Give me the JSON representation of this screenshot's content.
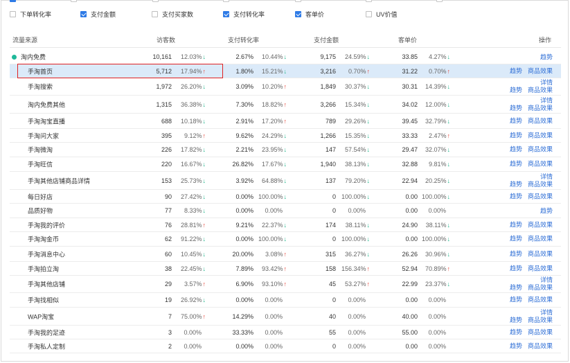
{
  "filters": [
    {
      "label": "下单转化率",
      "checked": false
    },
    {
      "label": "支付金额",
      "checked": true
    },
    {
      "label": "支付买家数",
      "checked": false
    },
    {
      "label": "支付转化率",
      "checked": true
    },
    {
      "label": "客单价",
      "checked": true
    },
    {
      "label": "UV价值",
      "checked": false
    }
  ],
  "columns": {
    "source": "流量来源",
    "visitors": "访客数",
    "conv": "支付转化率",
    "amount": "支付金额",
    "aov": "客单价",
    "action": "操作"
  },
  "actions": {
    "trend": "趋势",
    "effect": "商品效果",
    "detail": "详情"
  },
  "colors": {
    "accent": "#2f7be6",
    "down": "#1fb58b",
    "up": "#e5463a",
    "highlight": "#dbeaf9",
    "box": "#e02020"
  },
  "rows": [
    {
      "level": 0,
      "source": "淘内免费",
      "visitors": "10,161",
      "v_pct": "12.03%",
      "v_dir": "down",
      "conv": "2.67%",
      "c_pct": "10.44%",
      "c_dir": "down",
      "amount": "9,175",
      "a_pct": "24.59%",
      "a_dir": "down",
      "aov": "33.85",
      "o_pct": "4.27%",
      "o_dir": "down",
      "actions": "trend"
    },
    {
      "level": 1,
      "source": "手淘首页",
      "visitors": "5,712",
      "v_pct": "17.94%",
      "v_dir": "up",
      "conv": "1.80%",
      "c_pct": "15.21%",
      "c_dir": "down",
      "amount": "3,216",
      "a_pct": "0.70%",
      "a_dir": "up",
      "aov": "31.22",
      "o_pct": "0.70%",
      "o_dir": "up",
      "actions": "pair",
      "highlight": true
    },
    {
      "level": 1,
      "source": "手淘搜索",
      "visitors": "1,972",
      "v_pct": "26.20%",
      "v_dir": "down",
      "conv": "3.09%",
      "c_pct": "10.20%",
      "c_dir": "up",
      "amount": "1,849",
      "a_pct": "30.37%",
      "a_dir": "down",
      "aov": "30.31",
      "o_pct": "14.39%",
      "o_dir": "down",
      "actions": "stack"
    },
    {
      "level": 1,
      "source": "淘内免费其他",
      "visitors": "1,315",
      "v_pct": "36.38%",
      "v_dir": "down",
      "conv": "7.30%",
      "c_pct": "18.82%",
      "c_dir": "up",
      "amount": "3,266",
      "a_pct": "15.34%",
      "a_dir": "down",
      "aov": "34.02",
      "o_pct": "12.00%",
      "o_dir": "down",
      "actions": "stack"
    },
    {
      "level": 1,
      "source": "手淘淘宝直播",
      "visitors": "688",
      "v_pct": "10.18%",
      "v_dir": "down",
      "conv": "2.91%",
      "c_pct": "17.20%",
      "c_dir": "up",
      "amount": "789",
      "a_pct": "29.26%",
      "a_dir": "down",
      "aov": "39.45",
      "o_pct": "32.79%",
      "o_dir": "down",
      "actions": "pair"
    },
    {
      "level": 1,
      "source": "手淘问大家",
      "visitors": "395",
      "v_pct": "9.12%",
      "v_dir": "up",
      "conv": "9.62%",
      "c_pct": "24.29%",
      "c_dir": "down",
      "amount": "1,266",
      "a_pct": "15.35%",
      "a_dir": "down",
      "aov": "33.33",
      "o_pct": "2.47%",
      "o_dir": "up",
      "actions": "pair"
    },
    {
      "level": 1,
      "source": "手淘微淘",
      "visitors": "226",
      "v_pct": "17.82%",
      "v_dir": "down",
      "conv": "2.21%",
      "c_pct": "23.95%",
      "c_dir": "down",
      "amount": "147",
      "a_pct": "57.54%",
      "a_dir": "down",
      "aov": "29.47",
      "o_pct": "32.07%",
      "o_dir": "down",
      "actions": "pair"
    },
    {
      "level": 1,
      "source": "手淘旺信",
      "visitors": "220",
      "v_pct": "16.67%",
      "v_dir": "down",
      "conv": "26.82%",
      "c_pct": "17.67%",
      "c_dir": "down",
      "amount": "1,940",
      "a_pct": "38.13%",
      "a_dir": "down",
      "aov": "32.88",
      "o_pct": "9.81%",
      "o_dir": "down",
      "actions": "pair"
    },
    {
      "level": 1,
      "source": "手淘其他店铺商品详情",
      "visitors": "153",
      "v_pct": "25.73%",
      "v_dir": "down",
      "conv": "3.92%",
      "c_pct": "64.88%",
      "c_dir": "down",
      "amount": "137",
      "a_pct": "79.20%",
      "a_dir": "down",
      "aov": "22.94",
      "o_pct": "20.25%",
      "o_dir": "down",
      "actions": "stack"
    },
    {
      "level": 1,
      "source": "每日好店",
      "visitors": "90",
      "v_pct": "27.42%",
      "v_dir": "down",
      "conv": "0.00%",
      "c_pct": "100.00%",
      "c_dir": "down",
      "amount": "0",
      "a_pct": "100.00%",
      "a_dir": "down",
      "aov": "0.00",
      "o_pct": "100.00%",
      "o_dir": "down",
      "actions": "pair"
    },
    {
      "level": 1,
      "source": "品质好物",
      "visitors": "77",
      "v_pct": "8.33%",
      "v_dir": "down",
      "conv": "0.00%",
      "c_pct": "0.00%",
      "c_dir": "",
      "amount": "0",
      "a_pct": "0.00%",
      "a_dir": "",
      "aov": "0.00",
      "o_pct": "0.00%",
      "o_dir": "",
      "actions": "trend"
    },
    {
      "level": 1,
      "source": "手淘我的评价",
      "visitors": "76",
      "v_pct": "28.81%",
      "v_dir": "up",
      "conv": "9.21%",
      "c_pct": "22.37%",
      "c_dir": "down",
      "amount": "174",
      "a_pct": "38.11%",
      "a_dir": "down",
      "aov": "24.90",
      "o_pct": "38.11%",
      "o_dir": "down",
      "actions": "pair"
    },
    {
      "level": 1,
      "source": "手淘淘金币",
      "visitors": "62",
      "v_pct": "91.22%",
      "v_dir": "down",
      "conv": "0.00%",
      "c_pct": "100.00%",
      "c_dir": "down",
      "amount": "0",
      "a_pct": "100.00%",
      "a_dir": "down",
      "aov": "0.00",
      "o_pct": "100.00%",
      "o_dir": "down",
      "actions": "pair"
    },
    {
      "level": 1,
      "source": "手淘消息中心",
      "visitors": "60",
      "v_pct": "10.45%",
      "v_dir": "down",
      "conv": "20.00%",
      "c_pct": "3.08%",
      "c_dir": "up",
      "amount": "315",
      "a_pct": "36.27%",
      "a_dir": "down",
      "aov": "26.26",
      "o_pct": "30.96%",
      "o_dir": "down",
      "actions": "pair"
    },
    {
      "level": 1,
      "source": "手淘拍立淘",
      "visitors": "38",
      "v_pct": "22.45%",
      "v_dir": "down",
      "conv": "7.89%",
      "c_pct": "93.42%",
      "c_dir": "up",
      "amount": "158",
      "a_pct": "156.34%",
      "a_dir": "up",
      "aov": "52.94",
      "o_pct": "70.89%",
      "o_dir": "up",
      "actions": "pair"
    },
    {
      "level": 1,
      "source": "手淘其他店铺",
      "visitors": "29",
      "v_pct": "3.57%",
      "v_dir": "up",
      "conv": "6.90%",
      "c_pct": "93.10%",
      "c_dir": "up",
      "amount": "45",
      "a_pct": "53.27%",
      "a_dir": "up",
      "aov": "22.99",
      "o_pct": "23.37%",
      "o_dir": "down",
      "actions": "stack"
    },
    {
      "level": 1,
      "source": "手淘找相似",
      "visitors": "19",
      "v_pct": "26.92%",
      "v_dir": "down",
      "conv": "0.00%",
      "c_pct": "0.00%",
      "c_dir": "",
      "amount": "0",
      "a_pct": "0.00%",
      "a_dir": "",
      "aov": "0.00",
      "o_pct": "0.00%",
      "o_dir": "",
      "actions": "pair"
    },
    {
      "level": 1,
      "source": "WAP淘宝",
      "visitors": "7",
      "v_pct": "75.00%",
      "v_dir": "up",
      "conv": "14.29%",
      "c_pct": "0.00%",
      "c_dir": "",
      "amount": "40",
      "a_pct": "0.00%",
      "a_dir": "",
      "aov": "40.00",
      "o_pct": "0.00%",
      "o_dir": "",
      "actions": "stack"
    },
    {
      "level": 1,
      "source": "手淘我的足迹",
      "visitors": "3",
      "v_pct": "0.00%",
      "v_dir": "",
      "conv": "33.33%",
      "c_pct": "0.00%",
      "c_dir": "",
      "amount": "55",
      "a_pct": "0.00%",
      "a_dir": "",
      "aov": "55.00",
      "o_pct": "0.00%",
      "o_dir": "",
      "actions": "pair"
    },
    {
      "level": 1,
      "source": "手淘私人定制",
      "visitors": "2",
      "v_pct": "0.00%",
      "v_dir": "",
      "conv": "0.00%",
      "c_pct": "0.00%",
      "c_dir": "",
      "amount": "0",
      "a_pct": "0.00%",
      "a_dir": "",
      "aov": "0.00",
      "o_pct": "0.00%",
      "o_dir": "",
      "actions": "pair"
    }
  ]
}
